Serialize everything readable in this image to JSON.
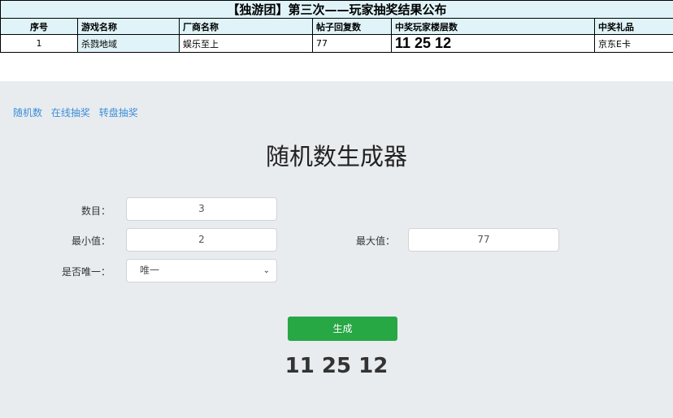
{
  "announcement": {
    "title": "【独游团】第三次——玩家抽奖结果公布",
    "headers": [
      "序号",
      "游戏名称",
      "厂商名称",
      "帖子回复数",
      "中奖玩家楼层数",
      "中奖礼品"
    ],
    "rows": [
      [
        "1",
        "杀戮地域",
        "娱乐至上",
        "77",
        "11 25 12",
        "京东E卡"
      ]
    ]
  },
  "nav": {
    "items": [
      "随机数",
      "在线抽奖",
      "转盘抽奖"
    ]
  },
  "generator": {
    "title": "随机数生成器",
    "count_label": "数目：",
    "count_value": "3",
    "min_label": "最小值：",
    "min_value": "2",
    "max_label": "最大值：",
    "max_value": "77",
    "unique_label": "是否唯一：",
    "unique_value": "唯一",
    "button_label": "生成",
    "result": "11 25 12"
  },
  "colors": {
    "header_bg": "#dff3f8",
    "panel_bg": "#e9ecef",
    "link": "#3b8fd9",
    "button": "#28a745"
  }
}
